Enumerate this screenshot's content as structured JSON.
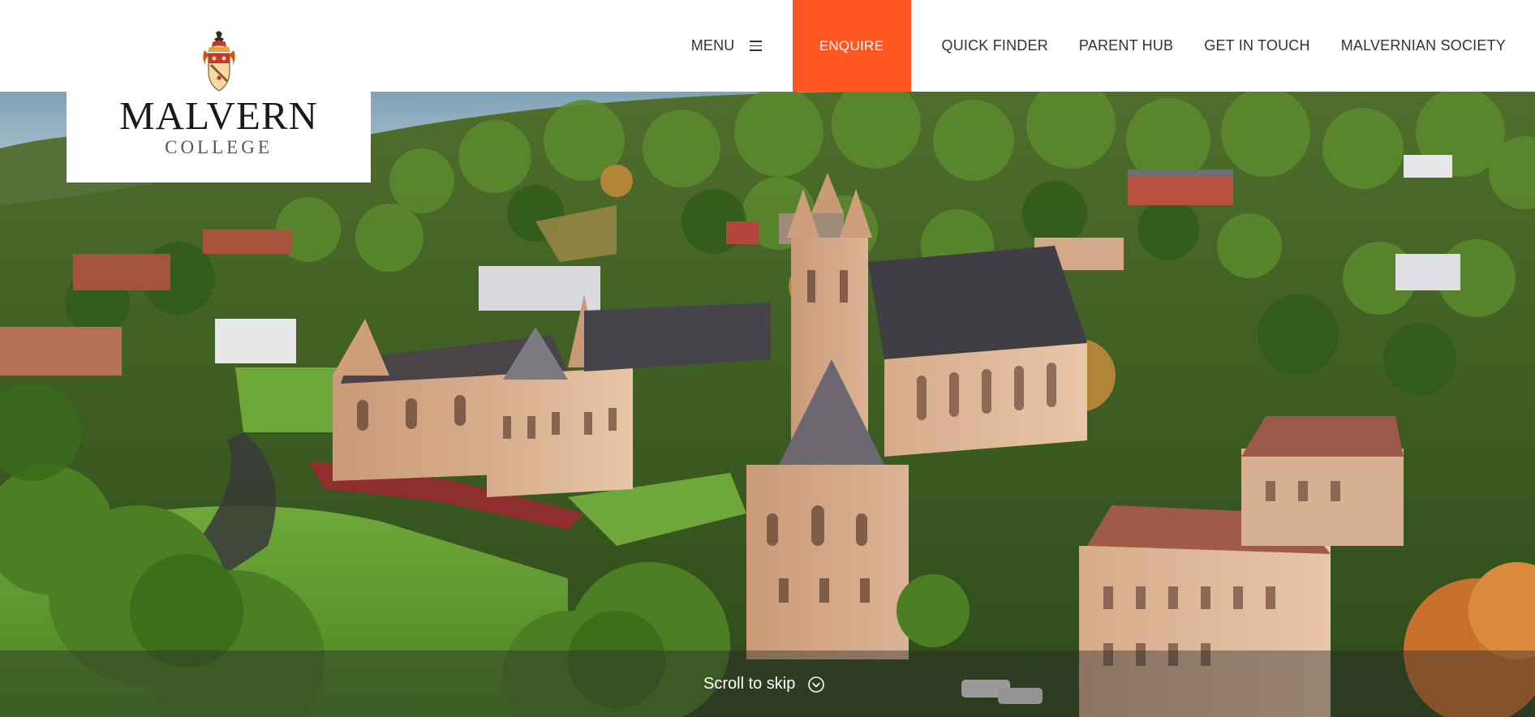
{
  "header": {
    "menu_label": "MENU",
    "menu_icon": "hamburger-icon",
    "enquire_label": "ENQUIRE",
    "links": [
      "QUICK FINDER",
      "PARENT HUB",
      "GET IN TOUCH",
      "MALVERNIAN SOCIETY"
    ]
  },
  "logo": {
    "title": "MALVERN",
    "subtitle": "COLLEGE",
    "crest_icon": "college-crest-icon"
  },
  "hero": {
    "image_subject": "aerial-campus-photo",
    "scroll_label": "Scroll to skip",
    "scroll_icon": "chevron-down-circle-icon"
  },
  "colors": {
    "accent": "#ff5722",
    "nav_text": "#333333",
    "overlay": "rgba(40,40,40,0.42)"
  }
}
